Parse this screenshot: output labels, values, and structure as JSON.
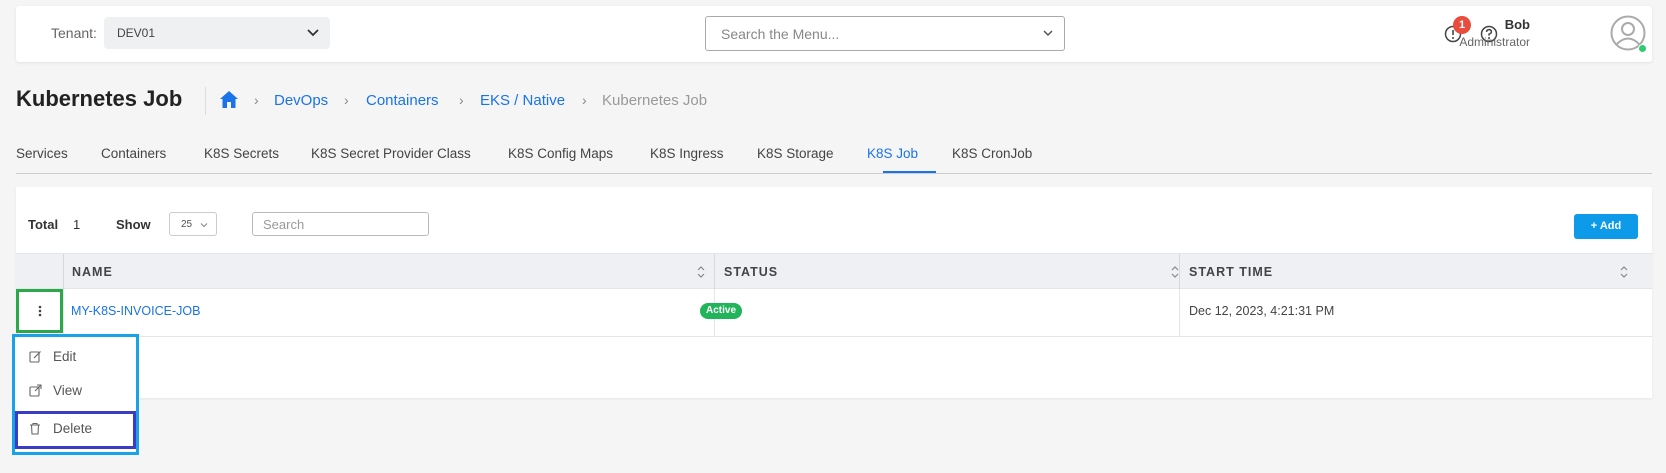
{
  "header": {
    "tenant_label": "Tenant:",
    "tenant_value": "DEV01",
    "menu_search_placeholder": "Search the Menu...",
    "alert_count": "1",
    "user_name": "Bob",
    "user_role": "Administrator"
  },
  "page": {
    "title": "Kubernetes Job",
    "breadcrumb": [
      "DevOps",
      "Containers",
      "EKS / Native",
      "Kubernetes Job"
    ]
  },
  "tabs": [
    {
      "label": "Services"
    },
    {
      "label": "Containers"
    },
    {
      "label": "K8S Secrets"
    },
    {
      "label": "K8S Secret Provider Class"
    },
    {
      "label": "K8S Config Maps"
    },
    {
      "label": "K8S Ingress"
    },
    {
      "label": "K8S Storage"
    },
    {
      "label": "K8S Job",
      "active": true
    },
    {
      "label": "K8S CronJob"
    }
  ],
  "grid": {
    "total_label": "Total",
    "total_value": "1",
    "show_label": "Show",
    "page_size": "25",
    "search_placeholder": "Search",
    "add_label": "+ Add",
    "columns": [
      "NAME",
      "STATUS",
      "START TIME"
    ],
    "rows": [
      {
        "name": "MY-K8S-INVOICE-JOB",
        "status": "Active",
        "start_time": "Dec 12, 2023, 4:21:31 PM"
      }
    ]
  },
  "row_menu": {
    "items": [
      "Edit",
      "View",
      "Delete"
    ]
  },
  "colors": {
    "accent": "#1a73e8",
    "add_button": "#0d9be9",
    "status_active": "#22b45a",
    "alert_badge": "#e74c3c",
    "highlight_green": "#2aa84a",
    "highlight_cyan": "#1aa2e8",
    "highlight_indigo": "#3a3cc4"
  }
}
